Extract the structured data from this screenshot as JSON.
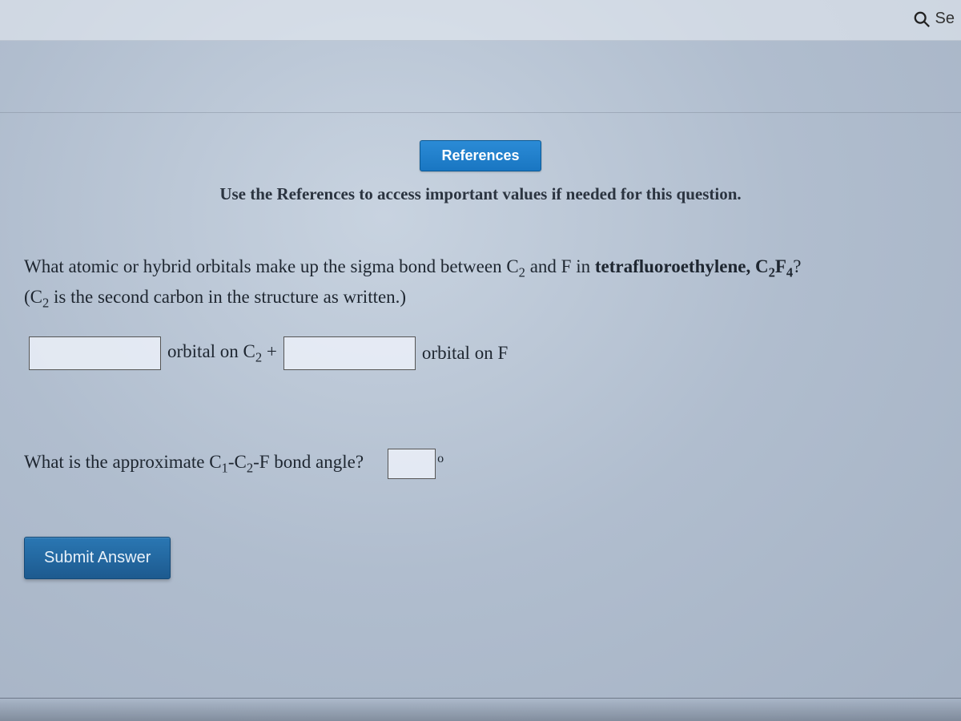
{
  "header": {
    "search_label_fragment": "Se"
  },
  "references_button": "References",
  "instruction": "Use the References to access important values if needed for this question.",
  "question": {
    "line1_pre": "What atomic or hybrid orbitals make up the sigma bond between C",
    "sub_c2": "2",
    "line1_mid": " and F in ",
    "compound_bold": "tetrafluoroethylene, C",
    "compound_sub1": "2",
    "compound_f": "F",
    "compound_sub2": "4",
    "compound_q": "?",
    "line2_pre": "(C",
    "line2_sub": "2",
    "line2_post": " is the second carbon in the structure as written.)"
  },
  "orbital_row": {
    "label1_pre": "orbital on C",
    "label1_sub": "2",
    "label1_post": " +",
    "label2": "orbital on F",
    "input1_value": "",
    "input2_value": ""
  },
  "angle_row": {
    "pre": "What is the approximate C",
    "sub1": "1",
    "dash1": "-C",
    "sub2": "2",
    "post": "-F bond angle?",
    "input_value": "",
    "degree": "o"
  },
  "submit_label": "Submit Answer"
}
